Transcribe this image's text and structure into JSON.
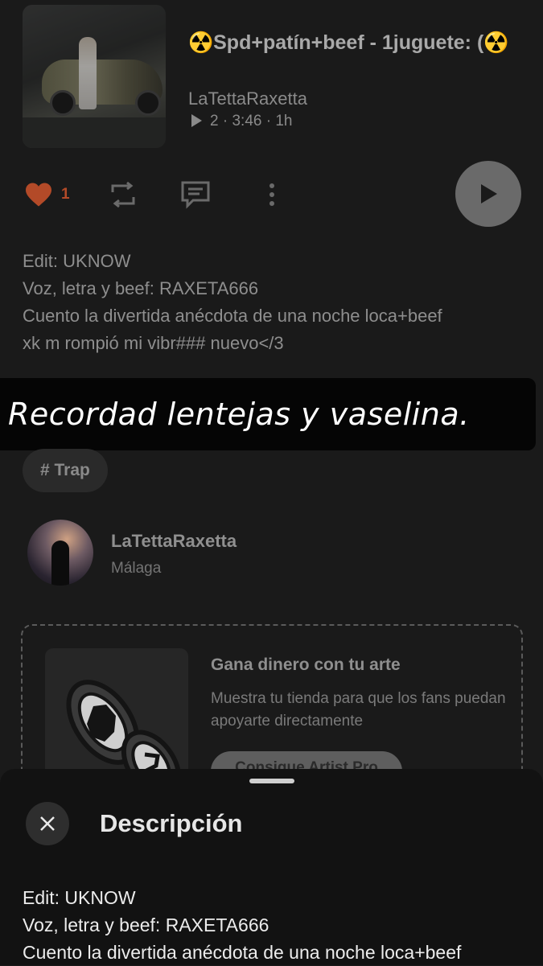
{
  "track": {
    "title": "☢️Spd+patín+beef - 1juguete: (☢️",
    "artist": "LaTettaRaxetta",
    "plays": "2",
    "duration": "3:46",
    "age": "1h",
    "separator": "·"
  },
  "actions": {
    "like_count": "1"
  },
  "description": {
    "line1": "Edit: UKNOW",
    "line2": "Voz, letra y beef: RAXETA666",
    "line3": "Cuento la divertida anécdota de una noche loca+beef",
    "line4": "xk m rompió mi vibr### nuevo</3"
  },
  "overlay_caption": "Recordad lentejas y vaselina.",
  "tag": "# Trap",
  "user": {
    "name": "LaTettaRaxetta",
    "location": "Málaga"
  },
  "promo": {
    "title": "Gana dinero con tu arte",
    "text": "Muestra tu tienda para que los fans puedan apoyarte directamente",
    "button": "Consigue Artist Pro"
  },
  "sheet": {
    "title": "Descripción",
    "line1": "Edit: UKNOW",
    "line2": "Voz, letra y beef: RAXETA666",
    "line3": "Cuento la divertida anécdota de una noche loca+beef"
  },
  "colors": {
    "background": "#1a1a1a",
    "like_accent": "#b34a28",
    "sheet_background": "#121212"
  }
}
